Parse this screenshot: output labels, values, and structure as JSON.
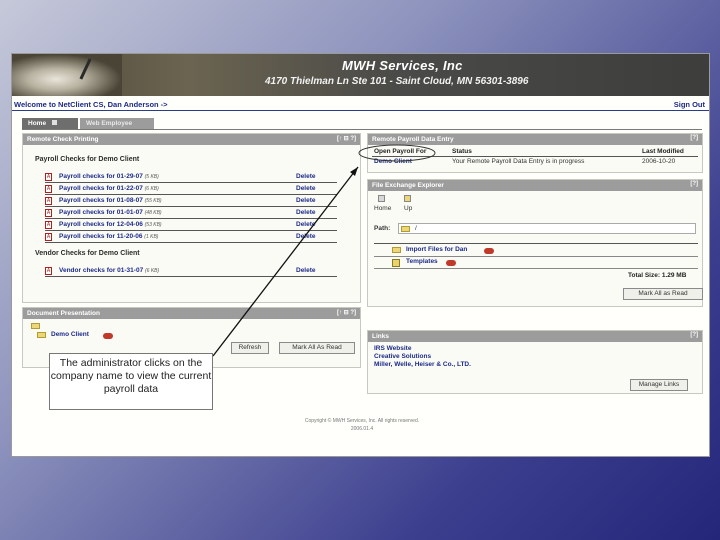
{
  "header": {
    "company": "MWH Services, Inc",
    "address": "4170 Thielman Ln Ste 101 - Saint Cloud, MN 56301-3896"
  },
  "welcome": "Welcome to NetClient CS, Dan Anderson ->",
  "signout": "Sign Out",
  "tabs": [
    "Home",
    "Web Employee"
  ],
  "check_printing": {
    "title": "Remote Check Printing",
    "controls": "[↑ ⊟ ?]",
    "payroll_heading": "Payroll Checks for Demo Client",
    "payroll_rows": [
      {
        "label": "Payroll checks for 01-29-07",
        "size": "(5 KB)",
        "action": "Delete"
      },
      {
        "label": "Payroll checks for 01-22-07",
        "size": "(6 KB)",
        "action": "Delete"
      },
      {
        "label": "Payroll checks for 01-08-07",
        "size": "(55 KB)",
        "action": "Delete"
      },
      {
        "label": "Payroll checks for 01-01-07",
        "size": "(48 KB)",
        "action": "Delete"
      },
      {
        "label": "Payroll checks for 12-04-06",
        "size": "(53 KB)",
        "action": "Delete"
      },
      {
        "label": "Payroll checks for 11-20-06",
        "size": "(1 KB)",
        "action": "Delete"
      }
    ],
    "vendor_heading": "Vendor Checks for Demo Client",
    "vendor_rows": [
      {
        "label": "Vendor checks for 01-31-07",
        "size": "(6 KB)",
        "action": "Delete"
      }
    ]
  },
  "document_presentation": {
    "title": "Document Presentation",
    "controls": "[↑ ⊟ ?]",
    "client": "Demo Client",
    "refresh": "Refresh",
    "mark_all": "Mark All As Read"
  },
  "payroll_data_entry": {
    "title": "Remote Payroll Data Entry",
    "controls": "[?]",
    "columns": [
      "Open Payroll For",
      "Status",
      "Last Modified"
    ],
    "row": {
      "client": "Demo Client",
      "status": "Your Remote Payroll Data Entry is in progress",
      "modified": "2006-10-20"
    }
  },
  "file_exchange": {
    "title": "File Exchange Explorer",
    "controls": "[?]",
    "nav": [
      "Home",
      "Up"
    ],
    "path_label": "Path:",
    "path_value": "/",
    "folders": [
      "Import Files for Dan",
      "Templates"
    ],
    "total_size": "Total Size: 1.29 MB",
    "mark_all": "Mark All as Read"
  },
  "links": {
    "title": "Links",
    "controls": "[?]",
    "items": [
      "IRS Website",
      "Creative Solutions",
      "Miller, Welle, Heiser & Co., LTD."
    ],
    "manage": "Manage Links"
  },
  "footer": {
    "copyright": "Copyright © MWH Services, Inc. All rights reserved.",
    "version": "2006.01.4"
  },
  "callout": "The administrator clicks on the company name to view the current payroll data"
}
